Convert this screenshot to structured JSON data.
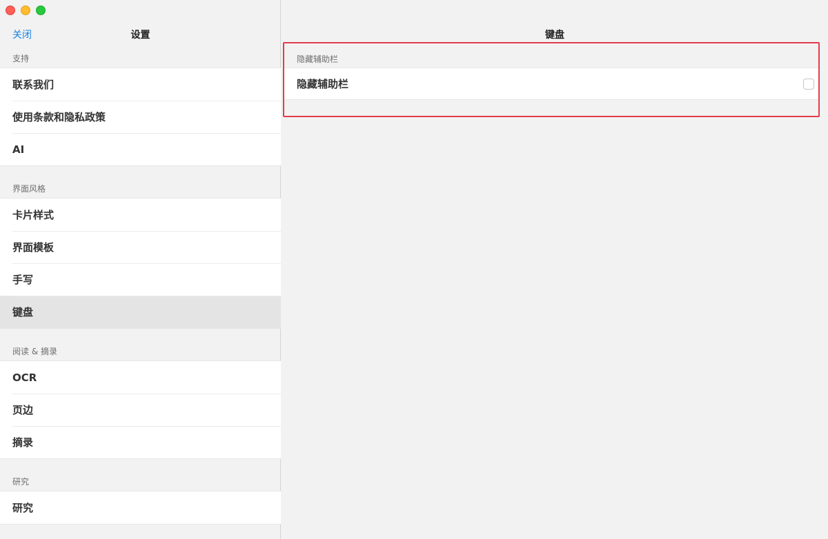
{
  "sidebar": {
    "close_label": "关闭",
    "title": "设置",
    "sections": [
      {
        "label": "支持",
        "items": [
          "联系我们",
          "使用条款和隐私政策",
          "AI"
        ]
      },
      {
        "label": "界面风格",
        "items": [
          "卡片样式",
          "界面模板",
          "手写",
          "键盘"
        ]
      },
      {
        "label": "阅读 & 摘录",
        "items": [
          "OCR",
          "页边",
          "摘录"
        ]
      },
      {
        "label": "研究",
        "items": [
          "研究"
        ]
      }
    ],
    "selected": "键盘"
  },
  "main": {
    "title": "键盘",
    "section_label": "隐藏辅助栏",
    "row_label": "隐藏辅助栏",
    "checkbox_checked": false
  },
  "colors": {
    "accent": "#1a82e2",
    "highlight": "#e23c4a"
  }
}
